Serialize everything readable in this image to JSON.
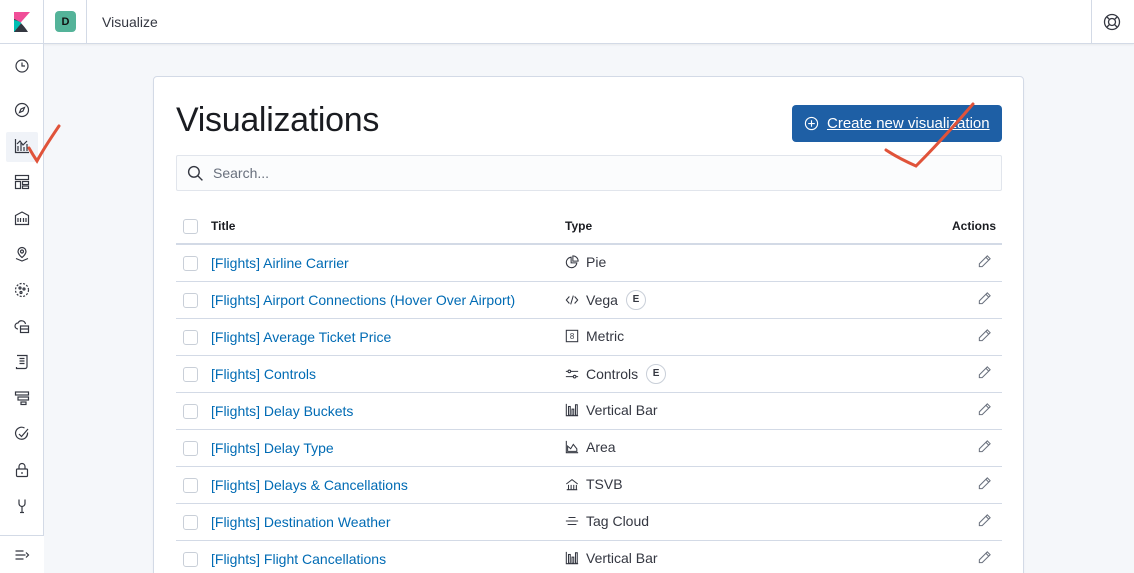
{
  "header": {
    "space_initial": "D",
    "app_title": "Visualize"
  },
  "main": {
    "page_title": "Visualizations",
    "create_button_label": "Create new visualization",
    "search_placeholder": "Search...",
    "columns": {
      "title": "Title",
      "type": "Type",
      "actions": "Actions"
    },
    "rows": [
      {
        "title": "[Flights] Airline Carrier",
        "type": "Pie",
        "type_icon": "pie-chart-icon",
        "experimental": false
      },
      {
        "title": "[Flights] Airport Connections (Hover Over Airport)",
        "type": "Vega",
        "type_icon": "code-icon",
        "experimental": true
      },
      {
        "title": "[Flights] Average Ticket Price",
        "type": "Metric",
        "type_icon": "metric-icon",
        "experimental": false
      },
      {
        "title": "[Flights] Controls",
        "type": "Controls",
        "type_icon": "controls-icon",
        "experimental": true
      },
      {
        "title": "[Flights] Delay Buckets",
        "type": "Vertical Bar",
        "type_icon": "bar-chart-icon",
        "experimental": false
      },
      {
        "title": "[Flights] Delay Type",
        "type": "Area",
        "type_icon": "area-chart-icon",
        "experimental": false
      },
      {
        "title": "[Flights] Delays & Cancellations",
        "type": "TSVB",
        "type_icon": "tsvb-icon",
        "experimental": false
      },
      {
        "title": "[Flights] Destination Weather",
        "type": "Tag Cloud",
        "type_icon": "tag-cloud-icon",
        "experimental": false
      },
      {
        "title": "[Flights] Flight Cancellations",
        "type": "Vertical Bar",
        "type_icon": "bar-chart-icon",
        "experimental": false
      }
    ],
    "experimental_badge": "E"
  },
  "colors": {
    "primary": "#1e5fa5",
    "link": "#006bb4",
    "annotation": "#e0533a"
  }
}
